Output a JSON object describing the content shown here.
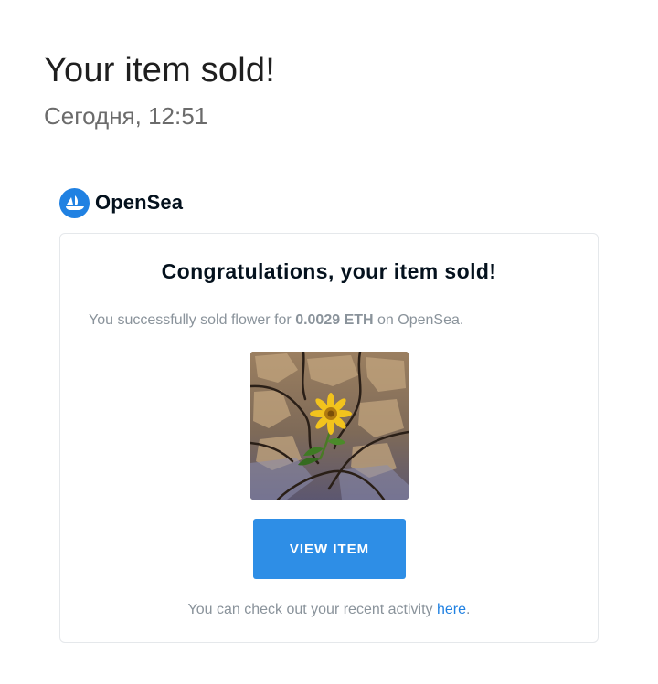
{
  "email": {
    "subject": "Your item sold!",
    "date": "Сегодня, 12:51"
  },
  "brand": {
    "name": "OpenSea",
    "logo_icon": "opensea-ship-icon",
    "color": "#2081e2"
  },
  "card": {
    "title": "Congratulations, your item sold!",
    "message_prefix": "You successfully sold flower for ",
    "price": "0.0029 ETH",
    "message_suffix": " on OpenSea.",
    "image_subject": "flower growing from cracked earth",
    "button_label": "VIEW ITEM",
    "button_color": "#2e8ee6",
    "activity_prefix": "You can check out your recent activity ",
    "activity_link": "here",
    "activity_suffix": "."
  }
}
